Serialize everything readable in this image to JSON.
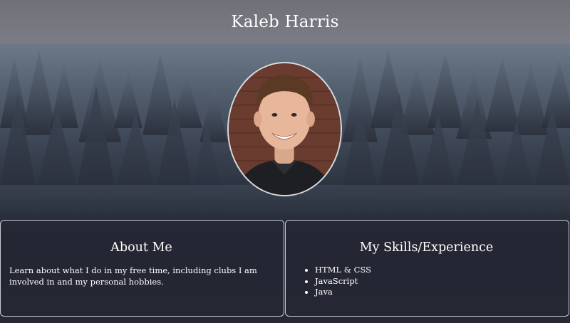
{
  "header": {
    "title": "Kaleb Harris"
  },
  "profile": {
    "photo_description": "profile-photo"
  },
  "about": {
    "heading": "About Me",
    "text": "Learn about what I do in my free time, including clubs I am involved in and my personal hobbies."
  },
  "skills": {
    "heading": "My Skills/Experience",
    "items": [
      "HTML & CSS",
      "JavaScript",
      "Java"
    ]
  },
  "colors": {
    "page_bg": "#262833",
    "border": "#c9ccd3",
    "header_bg": "#7a7a82"
  }
}
